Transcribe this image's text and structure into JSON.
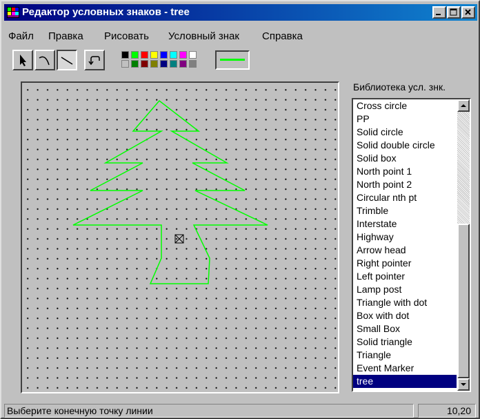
{
  "window": {
    "title": "Редактор условных знаков - tree",
    "minimize_icon": "minimize-icon",
    "maximize_icon": "maximize-icon",
    "close_icon": "close-icon"
  },
  "menu": {
    "items": [
      {
        "label": "Файл"
      },
      {
        "label": "Правка"
      },
      {
        "label": "Рисовать"
      },
      {
        "label": "Условный знак"
      },
      {
        "label": "Справка"
      }
    ]
  },
  "toolbar": {
    "tools": [
      {
        "icon": "select-arrow-icon"
      },
      {
        "icon": "arc-tool-icon"
      },
      {
        "icon": "line-tool-icon",
        "pressed": true
      },
      {
        "icon": "undo-icon"
      }
    ],
    "palette_row1": [
      "#000000",
      "#00ff00",
      "#ff0000",
      "#ffff00",
      "#0000ff",
      "#00ffff",
      "#ff00ff",
      "#ffffff"
    ],
    "palette_row2": [
      "#c0c0c0",
      "#008000",
      "#800000",
      "#808000",
      "#000080",
      "#008080",
      "#800080",
      "#808080"
    ],
    "current_line_color": "#00ff00"
  },
  "canvas": {
    "grid_visible": true,
    "shape_color": "#00ff00",
    "origin_marker_icon": "origin-cross-box-icon"
  },
  "library": {
    "label": "Библиотека усл. знк.",
    "items": [
      "Cross circle",
      "PP",
      "Solid circle",
      "Solid double circle",
      "Solid box",
      "North point 1",
      "North point 2",
      "Circular nth pt",
      "Trimble",
      "Interstate",
      "Highway",
      "Arrow head",
      "Right pointer",
      "Left pointer",
      "Lamp post",
      "Triangle with dot",
      "Box with dot",
      "Small Box",
      "Solid triangle",
      "Triangle",
      "Event Marker",
      "tree"
    ],
    "selected": "tree"
  },
  "status": {
    "message": "Выберите конечную точку линии",
    "coords": "10,20"
  }
}
